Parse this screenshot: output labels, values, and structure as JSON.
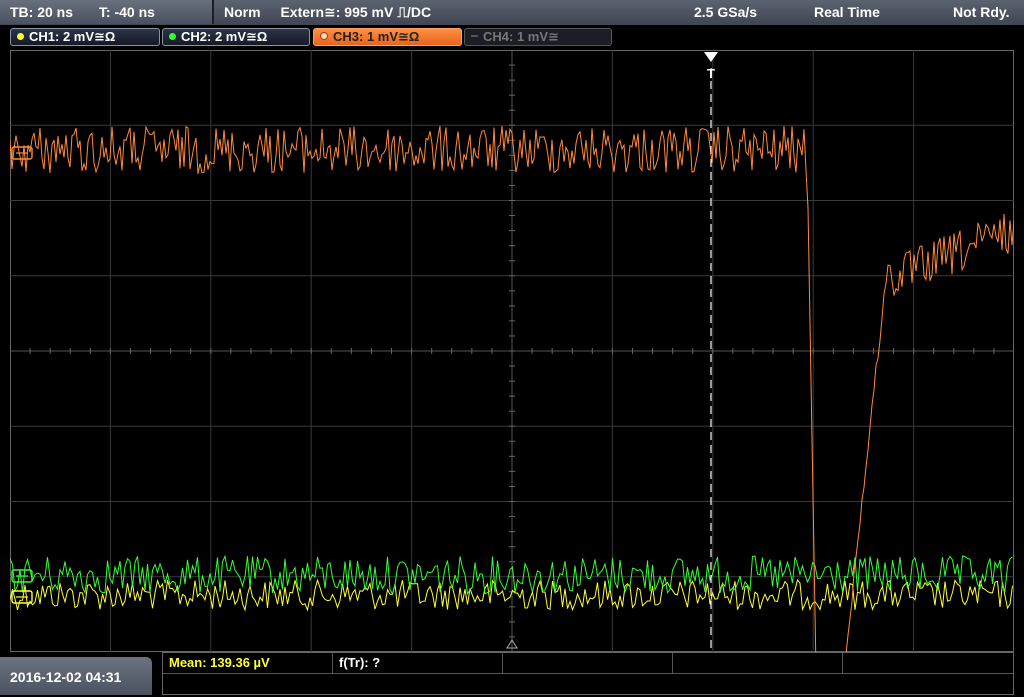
{
  "status_bar": {
    "timebase": "TB: 20 ns",
    "trigger_offset": "T: -40 ns",
    "trigger_mode": "Norm",
    "trigger_source": "Extern≅: 995 mV ⎍/DC",
    "sample_rate": "2.5 GSa/s",
    "acq_mode": "Real Time",
    "acq_state": "Not Rdy."
  },
  "channels": [
    {
      "label": "CH1: 2 mV≅Ω",
      "color": "#ffff33",
      "state": "on"
    },
    {
      "label": "CH2: 2 mV≅Ω",
      "color": "#33ff33",
      "state": "on"
    },
    {
      "label": "CH3: 1 mV≅Ω",
      "color": "#ff8a3d",
      "state": "active"
    },
    {
      "label": "CH4: 1 mV≅",
      "color": "#777777",
      "state": "off"
    }
  ],
  "trigger_marker": "T",
  "footer": {
    "datetime": "2016-12-02 04:31",
    "measurements": [
      {
        "label": "Mean: 139.36 µV",
        "color": "#ffff33"
      },
      {
        "label": "f(Tr): ?",
        "color": "#ffffff"
      }
    ]
  }
}
